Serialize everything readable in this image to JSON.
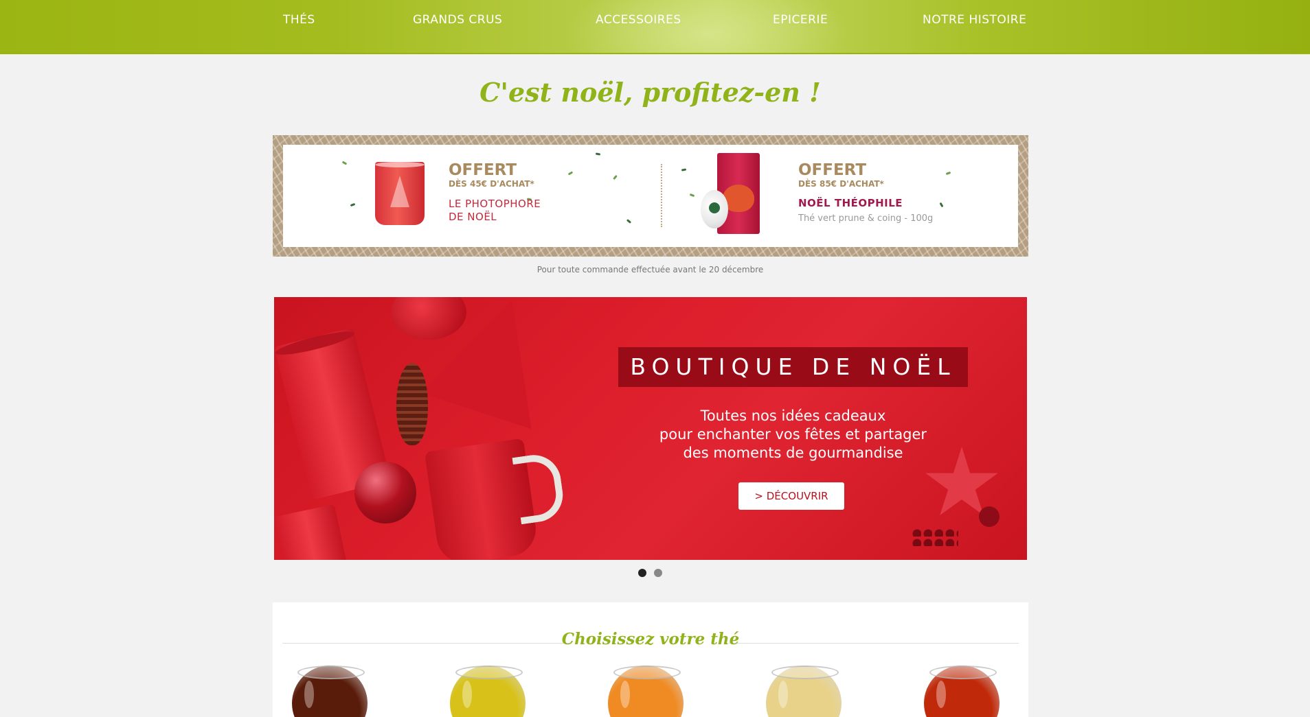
{
  "nav": {
    "items": [
      "Thés",
      "Grands crus",
      "Accessoires",
      "Epicerie",
      "Notre histoire"
    ]
  },
  "headline": "C'est noël, profitez-en !",
  "offer_banner": {
    "left": {
      "title": "OFFERT",
      "subtitle": "DÈS 45€ D'ACHAT*",
      "product_line1": "LE PHOTOPHORE",
      "product_line2": "DE NOËL"
    },
    "right": {
      "title": "OFFERT",
      "subtitle": "DÈS 85€ D'ACHAT*",
      "product": "NOËL THÉOPHILE",
      "description": "Thé vert prune & coing - 100g"
    },
    "note": "Pour toute commande effectuée avant le 20 décembre"
  },
  "hero": {
    "title": "BOUTIQUE DE NOËL",
    "text_lines": [
      "Toutes nos idées cadeaux",
      "pour enchanter vos fêtes et partager",
      "des moments de gourmandise"
    ],
    "button": "> DÉCOUVRIR",
    "slides_total": 2,
    "slide_active": 1
  },
  "tea_section": {
    "title": "Choisissez votre thé",
    "cups": [
      {
        "name": "dark-tea-cup-icon",
        "color": "#5a1c0a"
      },
      {
        "name": "yellow-tea-cup-icon",
        "color": "#d8c21a"
      },
      {
        "name": "orange-tea-cup-icon",
        "color": "#f08a22"
      },
      {
        "name": "pale-tea-cup-icon",
        "color": "#e8d28a"
      },
      {
        "name": "red-tea-cup-icon",
        "color": "#c02a0a"
      }
    ]
  },
  "colors": {
    "brand_green": "#8fb319",
    "nav_green": "#9bb512",
    "hero_red": "#d81e2b",
    "offer_gold": "#a98a5e",
    "offer_product_red": "#c4283a",
    "offer_product_purple": "#a11a4e"
  }
}
